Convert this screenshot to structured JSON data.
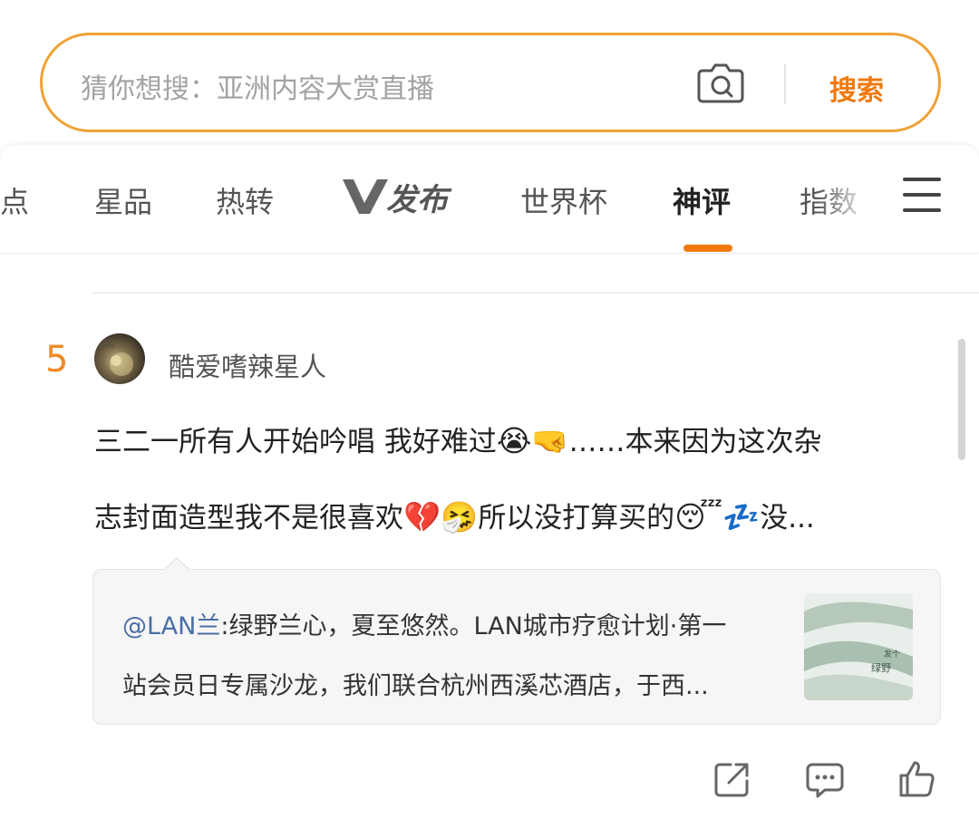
{
  "search": {
    "placeholder": "猜你想搜：亚洲内容大赏直播",
    "button_label": "搜索"
  },
  "tabs": [
    {
      "label": "点"
    },
    {
      "label": "星品"
    },
    {
      "label": "热转"
    },
    {
      "label": "V发布"
    },
    {
      "label": "世界杯"
    },
    {
      "label": "神评"
    },
    {
      "label": "指数"
    }
  ],
  "active_tab": "神评",
  "comment": {
    "rank": "5",
    "username": "酷爱嗜辣星人",
    "line1_text_a": "三二一所有人开始吟唱 我好难过",
    "line1_emoji_a": "😭",
    "line1_emoji_b": "🤜",
    "line1_text_b": "……本来因为这次杂",
    "line2_text_a": "志封面造型我不是很喜欢",
    "line2_emoji_a": "💔",
    "line2_emoji_b": "🤧",
    "line2_text_b": "所以没打算买的",
    "line2_emoji_c": "😴",
    "line2_emoji_d": "💤",
    "line2_text_c": "没..."
  },
  "quote": {
    "mention": "@LAN兰",
    "line1_rest": ":绿野兰心，夏至悠然。LAN城市疗愈计划·第一",
    "line2": "站会员日专属沙龙，我们联合杭州西溪芯酒店，于西..."
  },
  "colors": {
    "accent": "#f07a10",
    "search_border": "#f0a236",
    "mention": "#4a6fa5"
  }
}
